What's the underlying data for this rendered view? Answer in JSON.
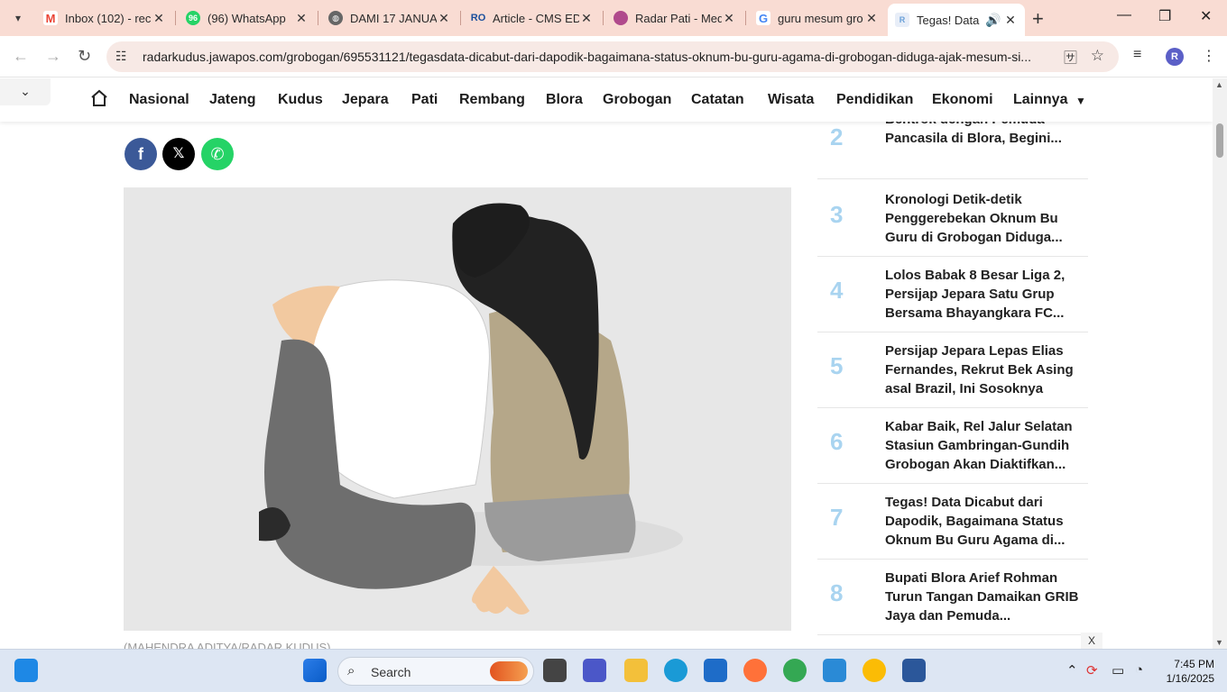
{
  "browser": {
    "tabs": [
      {
        "title": "Inbox (102) - rec",
        "favicon": "gmail-icon",
        "color": "#ea4335"
      },
      {
        "title": "(96) WhatsApp",
        "favicon": "whatsapp-icon",
        "color": "#25d366",
        "badge": "96"
      },
      {
        "title": "DAMI 17 JANUA",
        "favicon": "globe-icon",
        "color": "#555555"
      },
      {
        "title": "Article - CMS ED",
        "favicon": "ro-icon",
        "color": "#1b4f9c"
      },
      {
        "title": "Radar Pati - Med",
        "favicon": "radar-icon",
        "color": "#b04a8c"
      },
      {
        "title": "guru mesum gro",
        "favicon": "google-icon",
        "color": "#4285f4"
      },
      {
        "title": "Tegas! Data",
        "favicon": "radarkudus-icon",
        "color": "#6aa0d8",
        "active": true
      }
    ],
    "url": "radarkudus.jawapos.com/grobogan/695531121/tegasdata-dicabut-dari-dapodik-bagaimana-status-oknum-bu-guru-agama-di-grobogan-diduga-ajak-mesum-si...",
    "profile_initial": "R"
  },
  "site": {
    "nav": [
      "Nasional",
      "Jateng",
      "Kudus",
      "Jepara",
      "Pati",
      "Rembang",
      "Blora",
      "Grobogan",
      "Catatan",
      "Wisata",
      "Pendidikan",
      "Ekonomi",
      "Lainnya"
    ],
    "share": [
      {
        "name": "facebook",
        "glyph": "f",
        "color": "#3b5998"
      },
      {
        "name": "x",
        "glyph": "𝕏",
        "color": "#000000"
      },
      {
        "name": "whatsapp",
        "glyph": "✆",
        "color": "#25d366"
      }
    ],
    "caption": "(MAHENDRA ADITYA/RADAR KUDUS)",
    "popular": [
      {
        "num": "2",
        "title": "Massa Anggota GRIB Jateng Bentrok dengan Pemuda Pancasila di Blora, Begini..."
      },
      {
        "num": "3",
        "title": "Kronologi Detik-detik Penggerebekan Oknum Bu Guru di Grobogan Diduga..."
      },
      {
        "num": "4",
        "title": "Lolos Babak 8 Besar Liga 2, Persijap Jepara Satu Grup Bersama Bhayangkara FC..."
      },
      {
        "num": "5",
        "title": "Persijap Jepara Lepas Elias Fernandes, Rekrut Bek Asing asal Brazil, Ini Sosoknya"
      },
      {
        "num": "6",
        "title": "Kabar Baik, Rel Jalur Selatan Stasiun Gambringan-Gundih Grobogan Akan Diaktifkan..."
      },
      {
        "num": "7",
        "title": "Tegas! Data Dicabut dari Dapodik, Bagaimana Status Oknum Bu Guru Agama di..."
      },
      {
        "num": "8",
        "title": "Bupati Blora Arief Rohman Turun Tangan Damaikan GRIB Jaya dan Pemuda..."
      }
    ],
    "close_ad": "X"
  },
  "taskbar": {
    "search_label": "Search",
    "time": "7:45 PM",
    "date": "1/16/2025"
  }
}
